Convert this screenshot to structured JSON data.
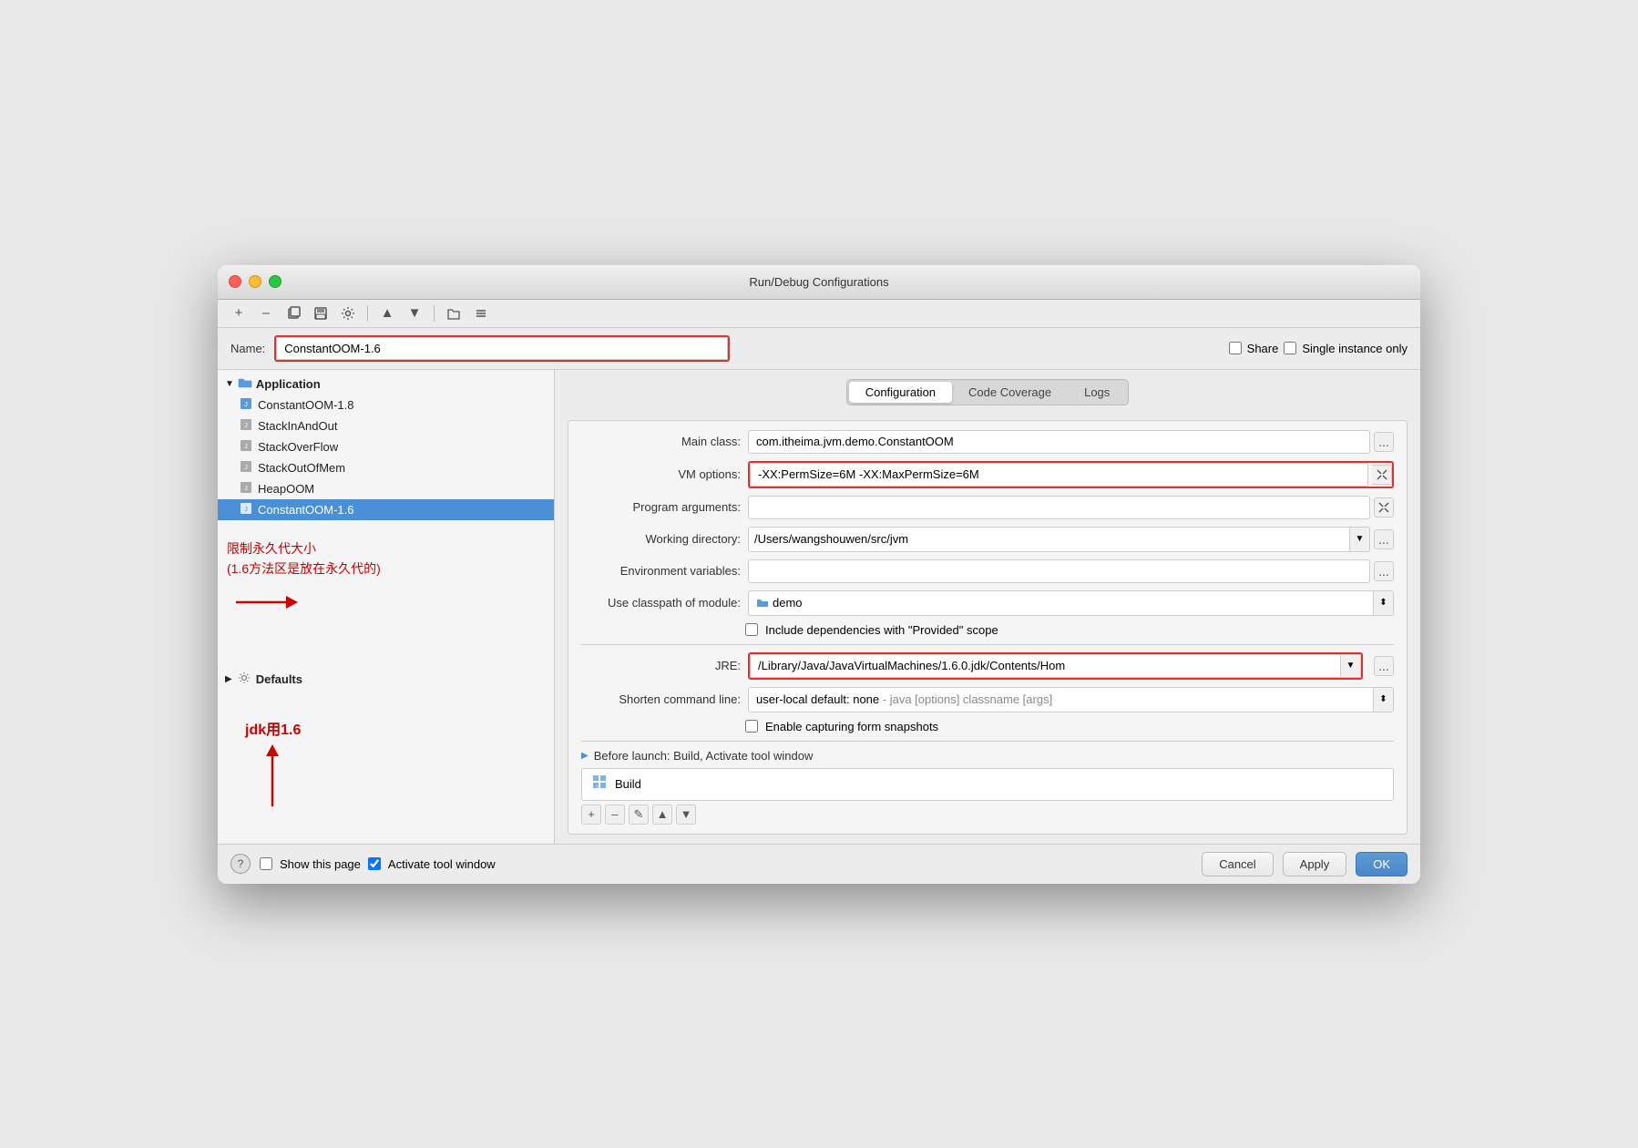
{
  "window": {
    "title": "Run/Debug Configurations"
  },
  "header": {
    "name_label": "Name:",
    "name_value": "ConstantOOM-1.6",
    "share_label": "Share",
    "single_instance_label": "Single instance only"
  },
  "toolbar": {
    "add": "+",
    "remove": "–",
    "copy": "⧉",
    "save": "💾",
    "settings": "⚙",
    "up": "▲",
    "down": "▼",
    "folder": "📁",
    "sort": "↕"
  },
  "sidebar": {
    "app_label": "Application",
    "items": [
      {
        "label": "ConstantOOM-1.8",
        "indent": 1
      },
      {
        "label": "StackInAndOut",
        "indent": 1
      },
      {
        "label": "StackOverFlow",
        "indent": 1
      },
      {
        "label": "StackOutOfMem",
        "indent": 1
      },
      {
        "label": "HeapOOM",
        "indent": 1
      },
      {
        "label": "ConstantOOM-1.6",
        "indent": 1,
        "selected": true
      }
    ],
    "defaults_label": "Defaults"
  },
  "annotations": {
    "text1": "限制永久代大小",
    "text2": "(1.6方法区是放在永久代的)",
    "text3": "jdk用1.6"
  },
  "tabs": {
    "items": [
      "Configuration",
      "Code Coverage",
      "Logs"
    ],
    "active": 0
  },
  "form": {
    "main_class_label": "Main class:",
    "main_class_value": "com.itheima.jvm.demo.ConstantOOM",
    "vm_options_label": "VM options:",
    "vm_options_value": "-XX:PermSize=6M -XX:MaxPermSize=6M",
    "program_args_label": "Program arguments:",
    "program_args_value": "",
    "working_dir_label": "Working directory:",
    "working_dir_value": "/Users/wangshouwen/src/jvm",
    "env_vars_label": "Environment variables:",
    "env_vars_value": "",
    "classpath_label": "Use classpath of module:",
    "classpath_value": "demo",
    "include_deps_label": "Include dependencies with \"Provided\" scope",
    "jre_label": "JRE:",
    "jre_value": "/Library/Java/JavaVirtualMachines/1.6.0.jdk/Contents/Hom",
    "shorten_label": "Shorten command line:",
    "shorten_value": "user-local default: none",
    "shorten_hint": " - java [options] classname [args]",
    "capture_label": "Enable capturing form snapshots"
  },
  "before_launch": {
    "header": "Before launch: Build, Activate tool window",
    "build_label": "Build",
    "build_icon": "↓"
  },
  "bottom": {
    "show_page_label": "Show this page",
    "activate_label": "Activate tool window",
    "cancel_label": "Cancel",
    "apply_label": "Apply",
    "ok_label": "OK"
  }
}
